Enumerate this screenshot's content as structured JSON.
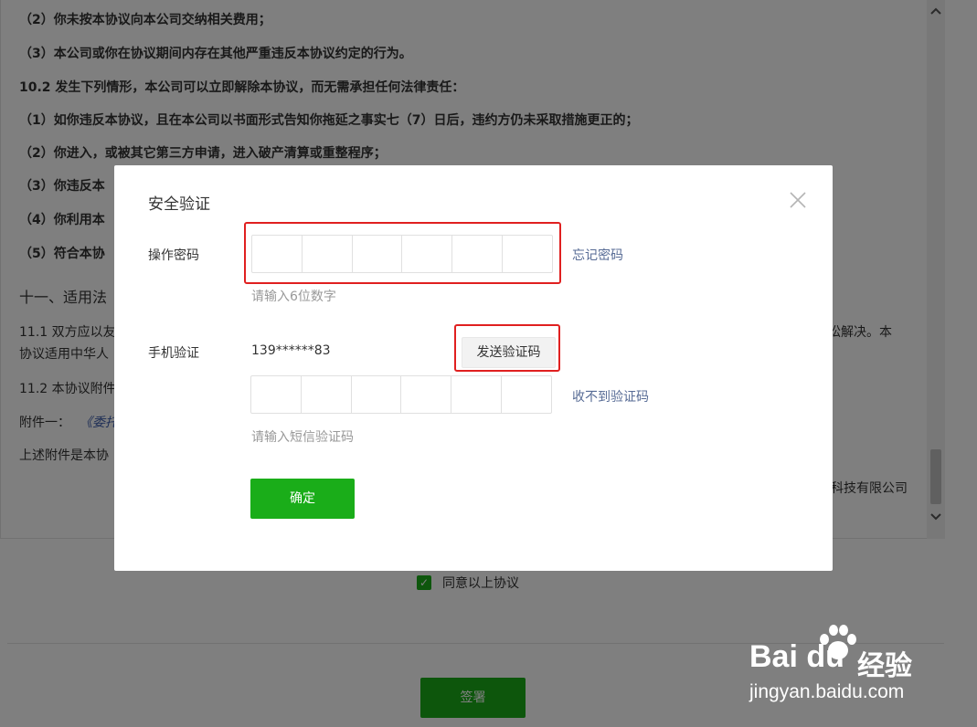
{
  "document": {
    "lines": [
      "（2）你未按本协议向本公司交纳相关费用；",
      "（3）本公司或你在协议期间内存在其他严重违反本协议约定的行为。",
      "10.2 发生下列情形，本公司可以立即解除本协议，而无需承担任何法律责任：",
      "（1）如你违反本协议，且在本公司以书面形式告知你拖延之事实七（7）日后，违约方仍未采取措施更正的；",
      "（2）你进入，或被其它第三方申请，进入破产清算或重整程序；",
      "（3）你违反本",
      "（4）你利用本",
      "（5）符合本协",
      "十一、适用法",
      "11.1 双方应以友",
      "讼解决。本",
      "协议适用中华人",
      "11.2 本协议附件",
      "附件一：",
      "《委托",
      "上述附件是本协",
      "科技有限公司"
    ]
  },
  "agreement": {
    "checkbox_mark": "✓",
    "label": "同意以上协议"
  },
  "sign_button_label": "签署",
  "dialog": {
    "title": "安全验证",
    "password_label": "操作密码",
    "password_hint": "请输入6位数字",
    "forgot_password_link": "忘记密码",
    "phone_label": "手机验证",
    "phone_number": "139******83",
    "send_code_button": "发送验证码",
    "sms_hint": "请输入短信验证码",
    "no_code_link": "收不到验证码",
    "confirm_button": "确定"
  },
  "watermark": {
    "logo_text": "Bai du",
    "logo_cn": "经验",
    "url": "jingyan.baidu.com"
  },
  "colors": {
    "primary_green": "#1aad19",
    "link_blue": "#576b95",
    "highlight_red": "#e02020",
    "overlay": "rgba(0,0,0,0.5)"
  }
}
